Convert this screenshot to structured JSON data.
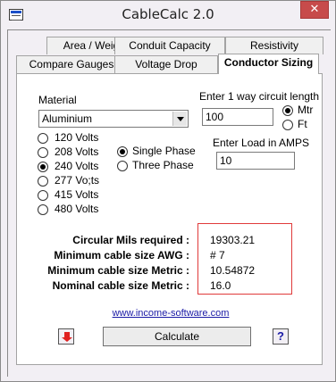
{
  "window": {
    "title": "CableCalc 2.0",
    "close_label": "✕"
  },
  "tabs": {
    "row1": [
      "Area / Weight",
      "Conduit Capacity",
      "Resistivity"
    ],
    "row2": [
      "Compare Gauges",
      "Voltage Drop",
      "Conductor Sizing"
    ],
    "active": "Conductor Sizing"
  },
  "material": {
    "label": "Material",
    "selected": "Aluminium"
  },
  "voltages": {
    "options": [
      "120 Volts",
      "208 Volts",
      "240 Volts",
      "277 Vo;ts",
      "415 Volts",
      "480 Volts"
    ],
    "selected": "240 Volts"
  },
  "phase": {
    "options": [
      "Single Phase",
      "Three Phase"
    ],
    "selected": "Single Phase"
  },
  "length": {
    "label": "Enter 1 way circuit length",
    "value": "100",
    "units": [
      "Mtr",
      "Ft"
    ],
    "selected_unit": "Mtr"
  },
  "load": {
    "label": "Enter Load in AMPS",
    "value": "10"
  },
  "results": [
    {
      "label": "Circular Mils required :",
      "value": "19303.21"
    },
    {
      "label": "Minimum cable size AWG :",
      "value": "# 7"
    },
    {
      "label": "Minimum cable size Metric :",
      "value": "10.54872"
    },
    {
      "label": "Nominal cable size Metric :",
      "value": "16.0"
    }
  ],
  "link_text": "www.income-software.com",
  "calculate_label": "Calculate",
  "help_label": "?",
  "icons": {
    "app": "cable-app-icon",
    "download": "red-down-arrow-icon",
    "help": "help-icon"
  },
  "colors": {
    "highlight_box": "#e03a3a",
    "link": "#1a1aa6"
  }
}
